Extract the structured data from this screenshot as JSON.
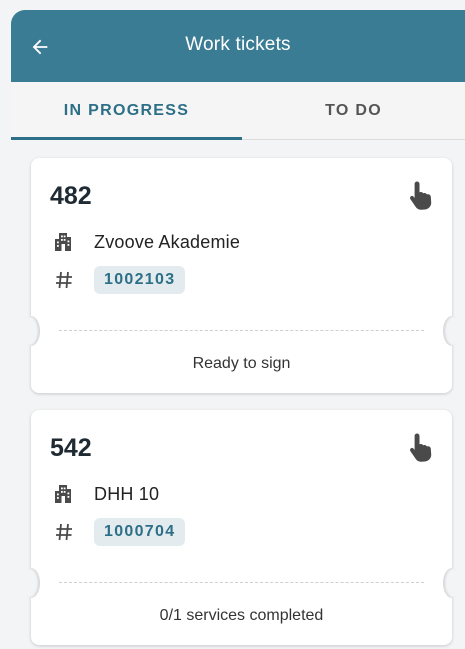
{
  "header": {
    "title": "Work tickets",
    "back_icon": "arrow-left-icon",
    "color": "#3a7c94"
  },
  "tabs": [
    {
      "label": "IN PROGRESS",
      "active": true
    },
    {
      "label": "TO DO",
      "active": false
    }
  ],
  "tickets": [
    {
      "number": "482",
      "company": "Zvoove Akademie",
      "id": "1002103",
      "status": "Ready to sign",
      "action_icon": "touch-hand-icon",
      "company_icon": "building-icon",
      "id_icon": "hash-icon"
    },
    {
      "number": "542",
      "company": "DHH 10",
      "id": "1000704",
      "status": "0/1 services completed",
      "action_icon": "touch-hand-icon",
      "company_icon": "building-icon",
      "id_icon": "hash-icon"
    }
  ]
}
